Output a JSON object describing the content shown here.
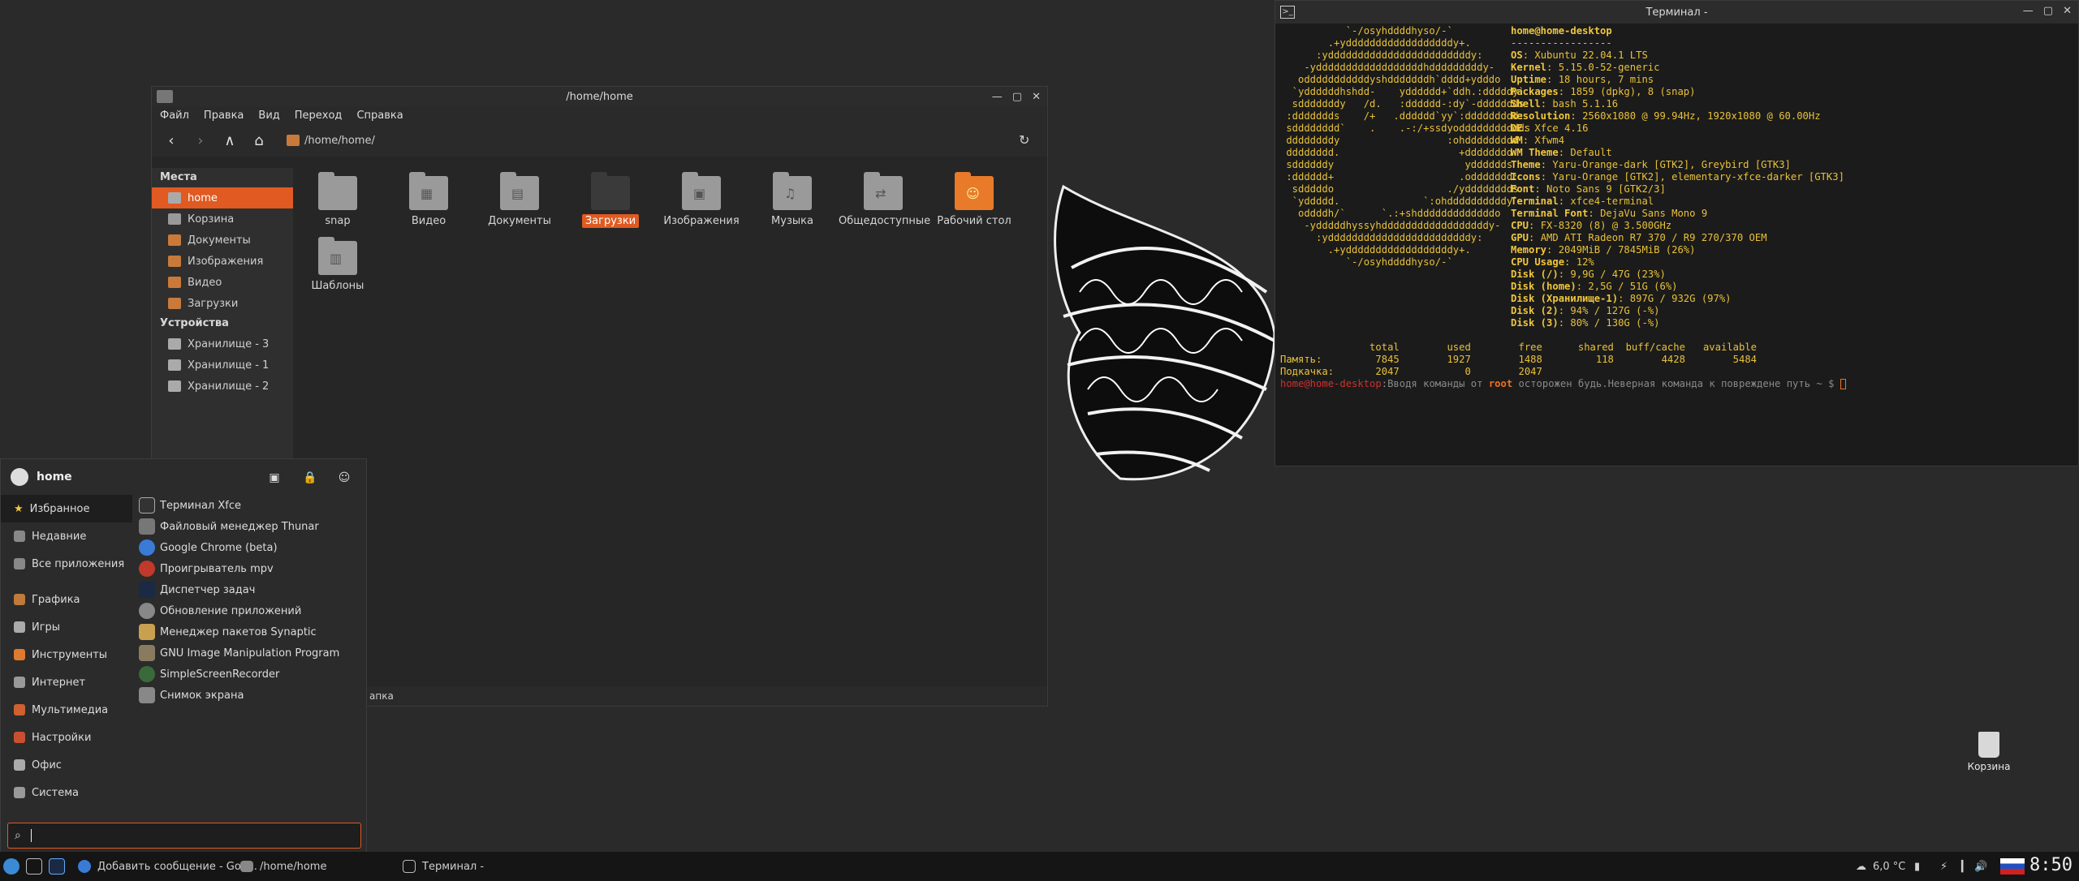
{
  "thunar": {
    "title": "/home/home",
    "menus": [
      "Файл",
      "Правка",
      "Вид",
      "Переход",
      "Справка"
    ],
    "path": "/home/home/",
    "places_header": "Места",
    "devices_header": "Устройства",
    "places": [
      "home",
      "Корзина",
      "Документы",
      "Изображения",
      "Видео",
      "Загрузки"
    ],
    "devices": [
      "Хранилище - 3",
      "Хранилище - 1",
      "Хранилище - 2"
    ],
    "files": [
      "snap",
      "Видео",
      "Документы",
      "Загрузки",
      "Изображения",
      "Музыка",
      "Общедоступные",
      "Рабочий стол",
      "Шаблоны"
    ],
    "status": "апка"
  },
  "terminal": {
    "title": "Терминал -",
    "logo": "           `-/osyhddddhyso/-`\n        .+yddddddddddddddddddy+.\n      :yddddddddddddddddddddddddy:\n    -yddddddddddddddddddhdddddddddy-\n   odddddddddddyshdddddddh`dddd+ydddo\n  `yddddddhshdd-    ydddddd+`ddh.:dddddy`\n  sdddddddy   /d.   :dddddd-:dy`-ddddddds\n :ddddddds    /+   .dddddd`yy`:ddddddddd:\n sdddddddd`    .    .-:/+ssdyoddddddddddds\n ddddddddy                  :ohddddddddd\n dddddddd.                    +dddddddd\n sddddddy                      ydddddds\n :dddddd+                     .oddddddd:\n  sdddddo                   ./ydddddddds\n  `yddddd.              `:ohddddddddddy`\n   oddddh/`      `.:+shdddddddddddddo\n    -ydddddhyssyhddddddddddddddddddy-\n      :yddddddddddddddddddddddddy:\n        .+yddddddddddddddddddy+.\n           `-/osyhddddhyso/-`",
    "user_host": "home@home-desktop",
    "separator": "-----------------",
    "info": [
      {
        "k": "OS",
        "v": "Xubuntu 22.04.1 LTS"
      },
      {
        "k": "Kernel",
        "v": "5.15.0-52-generic"
      },
      {
        "k": "Uptime",
        "v": "18 hours, 7 mins"
      },
      {
        "k": "Packages",
        "v": "1859 (dpkg), 8 (snap)"
      },
      {
        "k": "Shell",
        "v": "bash 5.1.16"
      },
      {
        "k": "Resolution",
        "v": "2560x1080 @ 99.94Hz, 1920x1080 @ 60.00Hz"
      },
      {
        "k": "DE",
        "v": "Xfce 4.16"
      },
      {
        "k": "WM",
        "v": "Xfwm4"
      },
      {
        "k": "WM Theme",
        "v": "Default"
      },
      {
        "k": "Theme",
        "v": "Yaru-Orange-dark [GTK2], Greybird [GTK3]"
      },
      {
        "k": "Icons",
        "v": "Yaru-Orange [GTK2], elementary-xfce-darker [GTK3]"
      },
      {
        "k": "Font",
        "v": "Noto Sans 9 [GTK2/3]"
      },
      {
        "k": "Terminal",
        "v": "xfce4-terminal"
      },
      {
        "k": "Terminal Font",
        "v": "DejaVu Sans Mono 9"
      },
      {
        "k": "CPU",
        "v": "FX-8320 (8) @ 3.500GHz"
      },
      {
        "k": "GPU",
        "v": "AMD ATI Radeon R7 370 / R9 270/370 OEM"
      },
      {
        "k": "Memory",
        "v": "2049MiB / 7845MiB (26%)"
      },
      {
        "k": "CPU Usage",
        "v": "12%"
      },
      {
        "k": "Disk (/)",
        "v": "9,9G / 47G (23%)"
      },
      {
        "k": "Disk (home)",
        "v": "2,5G / 51G (6%)"
      },
      {
        "k": "Disk (Хранилище-1)",
        "v": "897G / 932G (97%)"
      },
      {
        "k": "Disk (2)",
        "v": "94% / 127G (-%)"
      },
      {
        "k": "Disk (3)",
        "v": "80% / 130G (-%)"
      }
    ],
    "mem_table": "               total        used        free      shared  buff/cache   available\nПамять:         7845        1927        1488         118        4428        5484\nПодкачка:       2047           0        2047",
    "prompt_user": "home@home-desktop",
    "prompt_text_a": ":Вводя команды от ",
    "prompt_root": "root",
    "prompt_text_b": " осторожен будь.Неверная команда к повреждене путь ~ $ "
  },
  "menu": {
    "username": "home",
    "categories": [
      "Избранное",
      "Недавние",
      "Все приложения",
      "Графика",
      "Игры",
      "Инструменты",
      "Интернет",
      "Мультимедиа",
      "Настройки",
      "Офис",
      "Система"
    ],
    "apps": [
      "Терминал Xfce",
      "Файловый менеджер Thunar",
      "Google Chrome (beta)",
      "Проигрыватель mpv",
      "Диспетчер задач",
      "Обновление приложений",
      "Менеджер пакетов Synaptic",
      "GNU Image Manipulation Program",
      "SimpleScreenRecorder",
      "Снимок экрана"
    ],
    "search_value": ""
  },
  "desktop": {
    "trash_label": "Корзина"
  },
  "panel": {
    "task_chrome": "Добавить сообщение - Goo...",
    "task_thunar": "/home/home",
    "task_terminal": "Терминал -",
    "weather": "6,0 °C",
    "clock": "8:50"
  }
}
